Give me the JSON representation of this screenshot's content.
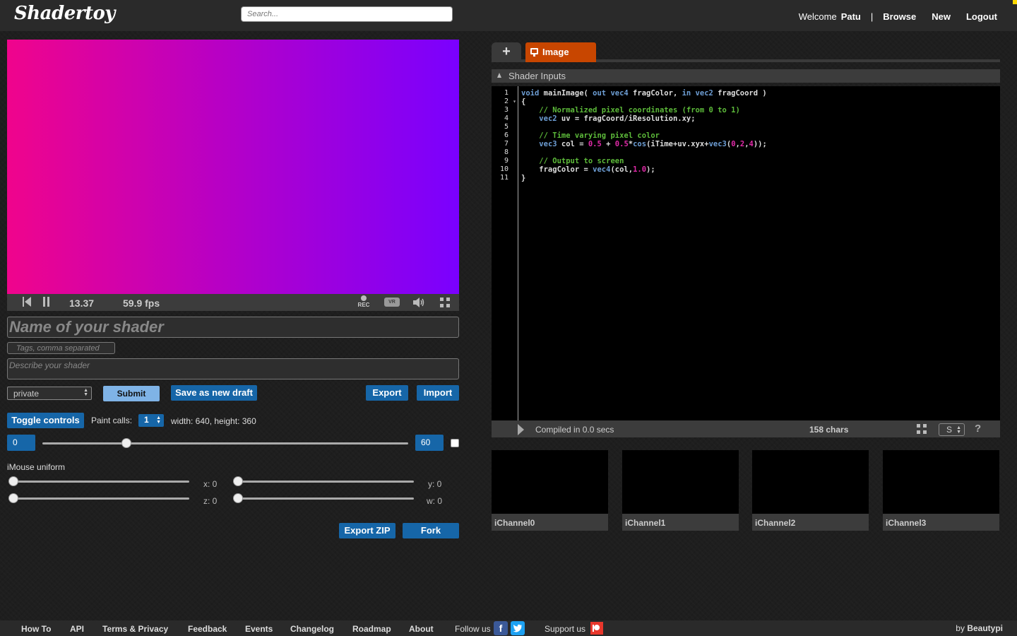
{
  "header": {
    "logo": "Shadertoy",
    "search_placeholder": "Search...",
    "welcome": "Welcome",
    "username": "Patu",
    "separator": "|",
    "browse": "Browse",
    "new": "New",
    "logout": "Logout"
  },
  "player": {
    "time": "13.37",
    "fps": "59.9 fps",
    "rec_label": "REC",
    "vr_label": "VR"
  },
  "form": {
    "name_placeholder": "Name of your shader",
    "tags_placeholder": "Tags, comma separated",
    "description_placeholder": "Describe your shader",
    "visibility": "private",
    "submit": "Submit",
    "save_draft": "Save as new draft",
    "export": "Export",
    "import": "Import"
  },
  "controls": {
    "toggle": "Toggle controls",
    "paint_calls_label": "Paint calls:",
    "paint_calls_value": "1",
    "resolution": "width: 640, height: 360",
    "range_min": "0",
    "range_max": "60",
    "imouse_label": "iMouse uniform",
    "mouse_x": "x: 0",
    "mouse_y": "y: 0",
    "mouse_z": "z: 0",
    "mouse_w": "w: 0",
    "export_zip": "Export ZIP",
    "fork": "Fork"
  },
  "editor": {
    "add_tab": "+",
    "tab_image": "Image",
    "shader_inputs": "Shader Inputs",
    "line_numbers": [
      "1",
      "2",
      "3",
      "4",
      "5",
      "6",
      "7",
      "8",
      "9",
      "10",
      "11"
    ],
    "compiled": "Compiled in 0.0 secs",
    "chars": "158 chars",
    "font_size": "S",
    "help": "?"
  },
  "channels": [
    "iChannel0",
    "iChannel1",
    "iChannel2",
    "iChannel3"
  ],
  "footer": {
    "links": [
      "How To",
      "API",
      "Terms & Privacy",
      "Feedback",
      "Events",
      "Changelog",
      "Roadmap",
      "About"
    ],
    "follow": "Follow us",
    "support": "Support us",
    "by": "by",
    "author": "Beautypi"
  },
  "colors": {
    "accent_blue": "#1666a8",
    "tab_orange": "#c84600",
    "gradient_start": "#f0048c",
    "gradient_end": "#7a00ff"
  }
}
